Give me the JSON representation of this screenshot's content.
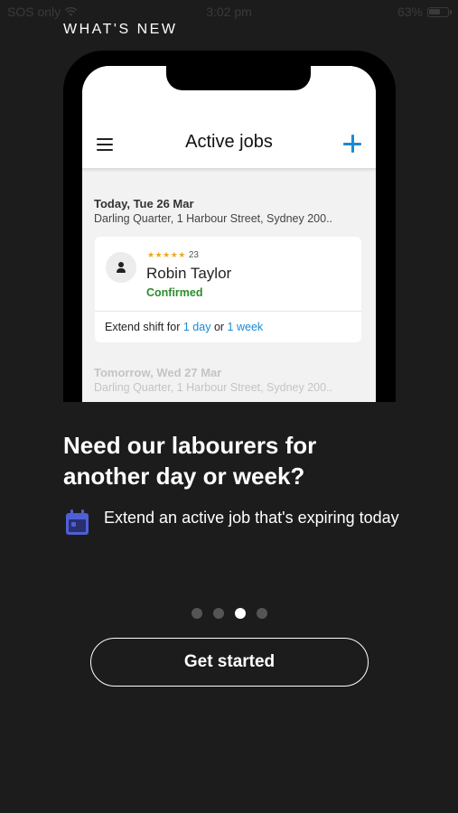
{
  "status_bar": {
    "carrier": "SOS only",
    "time": "3:02 pm",
    "battery": "63%",
    "battery_level": 0.63
  },
  "section_label": "WHAT'S NEW",
  "mockup": {
    "title": "Active jobs",
    "job": {
      "date": "Today, Tue 26 Mar",
      "address": "Darling Quarter, 1 Harbour Street, Sydney 200..",
      "rating_stars": "★★★★★",
      "rating_count": "23",
      "worker_name": "Robin Taylor",
      "status": "Confirmed",
      "extend_prefix": "Extend shift for",
      "extend_day": "1 day",
      "extend_or": "or",
      "extend_week": "1 week"
    },
    "next_job": {
      "date": "Tomorrow, Wed 27 Mar",
      "address": "Darling Quarter, 1 Harbour Street, Sydney 200.."
    }
  },
  "headline": "Need our labourers for another day or week?",
  "feature": {
    "icon": "calendar-icon",
    "text": "Extend an active job that's expiring today"
  },
  "pager": {
    "total": 4,
    "active_index": 2
  },
  "cta_label": "Get started",
  "colors": {
    "background": "#1c1c1c",
    "accent_blue": "#1a8ad4",
    "confirmed_green": "#2e8b2e",
    "star_orange": "#f0a81e",
    "calendar_blue": "#4f5fd6"
  }
}
